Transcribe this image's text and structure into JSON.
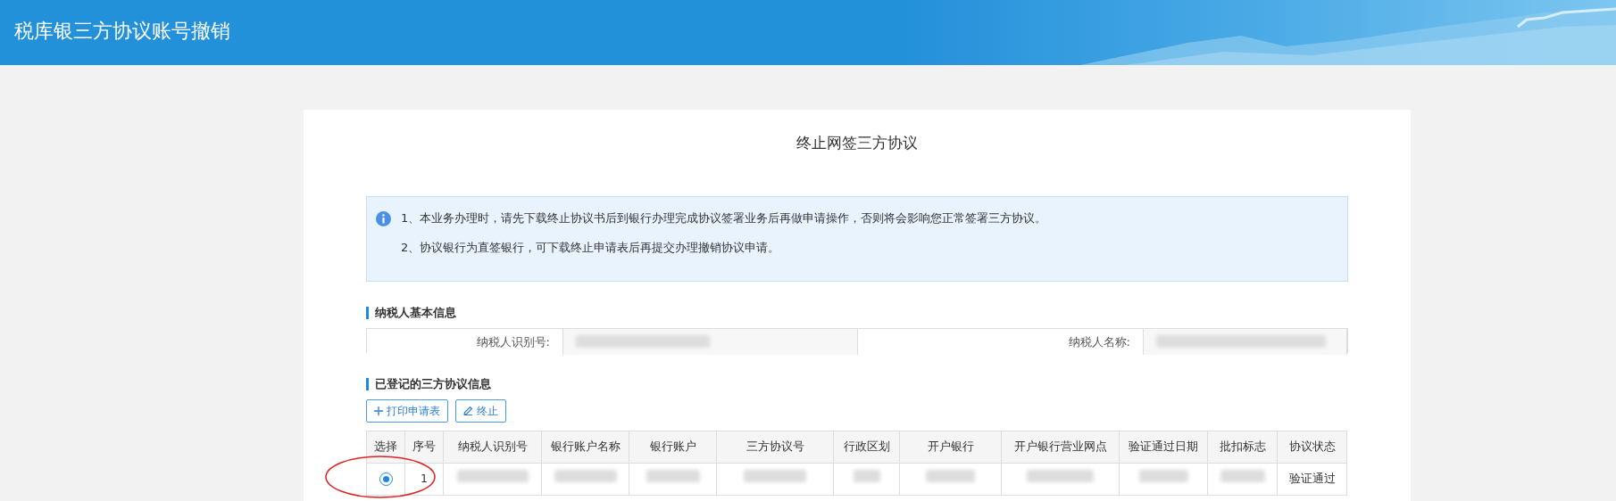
{
  "header": {
    "title": "税库银三方协议账号撤销"
  },
  "card": {
    "title": "终止网签三方协议",
    "notices": [
      "1、本业务办理时，请先下载终止协议书后到银行办理完成协议签署业务后再做申请操作，否则将会影响您正常签署三方协议。",
      "2、协议银行为直签银行，可下载终止申请表后再提交办理撤销协议申请。"
    ],
    "taxpayer": {
      "heading": "纳税人基本信息",
      "fields": [
        {
          "label": "纳税人识别号:",
          "kind": "redacted"
        },
        {
          "label": "纳税人名称:",
          "kind": "redacted"
        }
      ]
    },
    "agreements": {
      "heading": "已登记的三方协议信息",
      "buttons": [
        {
          "label": "打印申请表",
          "kind": "add"
        },
        {
          "label": "终止",
          "kind": "edit"
        }
      ],
      "columns": [
        "选择",
        "序号",
        "纳税人识别号",
        "银行账户名称",
        "银行账户",
        "三方协议号",
        "行政区划",
        "开户银行",
        "开户银行营业网点",
        "验证通过日期",
        "批扣标志",
        "协议状态"
      ],
      "rows": [
        {
          "selected": true,
          "circled": true,
          "cells": [
            {
              "kind": "radio"
            },
            {
              "kind": "text",
              "text": "1"
            },
            {
              "kind": "redacted"
            },
            {
              "kind": "redacted"
            },
            {
              "kind": "redacted"
            },
            {
              "kind": "redacted"
            },
            {
              "kind": "redacted"
            },
            {
              "kind": "redacted"
            },
            {
              "kind": "redacted"
            },
            {
              "kind": "redacted"
            },
            {
              "kind": "redacted"
            },
            {
              "kind": "text",
              "text": "验证通过"
            }
          ]
        }
      ]
    }
  }
}
